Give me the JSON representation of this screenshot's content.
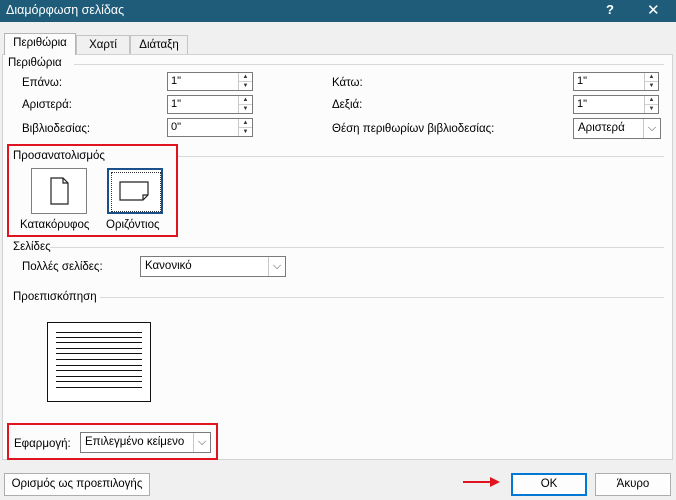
{
  "window": {
    "title": "Διαμόρφωση σελίδας",
    "help": "?",
    "close": "✕"
  },
  "tabs": [
    {
      "label": "Περιθώρια"
    },
    {
      "label": "Χαρτί"
    },
    {
      "label": "Διάταξη"
    }
  ],
  "margins": {
    "group_label": "Περιθώρια",
    "top": {
      "label": "Επάνω:",
      "value": "1\""
    },
    "left": {
      "label": "Αριστερά:",
      "value": "1\""
    },
    "gutter": {
      "label": "Βιβλιοδεσίας:",
      "value": "0\""
    },
    "bottom": {
      "label": "Κάτω:",
      "value": "1\""
    },
    "right": {
      "label": "Δεξιά:",
      "value": "1\""
    },
    "gutter_position": {
      "label": "Θέση περιθωρίων βιβλιοδεσίας:",
      "value": "Αριστερά"
    }
  },
  "orientation": {
    "group_label": "Προσανατολισμός",
    "portrait": "Κατακόρυφος",
    "landscape": "Οριζόντιος",
    "selected": "landscape"
  },
  "pages": {
    "group_label": "Σελίδες",
    "multiple_label": "Πολλές σελίδες:",
    "multiple_value": "Κανονικό"
  },
  "preview": {
    "group_label": "Προεπισκόπηση"
  },
  "apply": {
    "label": "Εφαρμογή:",
    "value": "Επιλεγμένο κείμενο"
  },
  "buttons": {
    "default": "Ορισμός ως προεπιλογής",
    "ok": "OK",
    "cancel": "Άκυρο"
  },
  "colors": {
    "titlebar": "#1f5c7a",
    "highlight": "#e0141e",
    "ok_border": "#0078d4"
  }
}
